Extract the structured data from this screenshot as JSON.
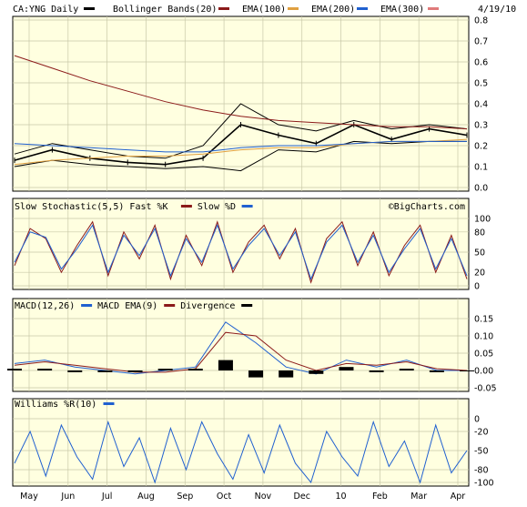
{
  "header": {
    "symbol_label": "CA:YNG Daily",
    "date": "4/19/10",
    "indicators": [
      {
        "label": "Bollinger Bands(20)",
        "color": "#000000"
      },
      {
        "label": "EMA(100)",
        "color": "#8b1a1a"
      },
      {
        "label": "EMA(200)",
        "color": "#e0a040"
      },
      {
        "label": "EMA(300)",
        "color": "#2060d0"
      }
    ],
    "ema300_swatch_color": "#e07a7a"
  },
  "watermark": "©BigCharts.com",
  "colors": {
    "panel_bg": "#ffffe0",
    "grid": "#c8c8a8",
    "price_bar": "#000000",
    "bollinger": "#000000",
    "ema100": "#8b1a1a",
    "ema200": "#e0a040",
    "ema300": "#2060d0",
    "fast_k": "#8b1a1a",
    "slow_d": "#2060d0",
    "macd": "#2060d0",
    "macd_ema": "#8b1a1a",
    "divergence": "#000000",
    "williams": "#2060d0"
  },
  "x_axis_labels": [
    "May",
    "Jun",
    "Jul",
    "Aug",
    "Sep",
    "Oct",
    "Nov",
    "Dec",
    "10",
    "Feb",
    "Mar",
    "Apr"
  ],
  "chart_data": [
    {
      "type": "line",
      "title": "CA:YNG Daily",
      "panel": "price",
      "ylim": [
        0.0,
        0.8
      ],
      "yticks": [
        "0.8",
        "0.7",
        "0.6",
        "0.5",
        "0.4",
        "0.3",
        "0.2",
        "0.1",
        "0.0"
      ],
      "x": [
        "May",
        "Jun",
        "Jul",
        "Aug",
        "Sep",
        "Oct",
        "Nov",
        "Dec",
        "10",
        "Feb",
        "Mar",
        "Apr"
      ],
      "series": [
        {
          "name": "Price",
          "values": [
            0.13,
            0.18,
            0.14,
            0.12,
            0.11,
            0.14,
            0.3,
            0.25,
            0.21,
            0.3,
            0.23,
            0.28,
            0.25
          ]
        },
        {
          "name": "Bollinger Bands(20) upper",
          "values": [
            0.16,
            0.21,
            0.18,
            0.15,
            0.14,
            0.2,
            0.4,
            0.3,
            0.27,
            0.32,
            0.28,
            0.3,
            0.28
          ]
        },
        {
          "name": "Bollinger Bands(20) lower",
          "values": [
            0.1,
            0.13,
            0.11,
            0.1,
            0.09,
            0.1,
            0.08,
            0.18,
            0.17,
            0.22,
            0.21,
            0.22,
            0.22
          ]
        },
        {
          "name": "EMA(100)",
          "values": [
            0.63,
            0.57,
            0.51,
            0.46,
            0.41,
            0.37,
            0.34,
            0.32,
            0.31,
            0.3,
            0.29,
            0.29,
            0.28
          ]
        },
        {
          "name": "EMA(200)",
          "values": [
            0.11,
            0.13,
            0.14,
            0.15,
            0.15,
            0.16,
            0.18,
            0.19,
            0.19,
            0.21,
            0.22,
            0.22,
            0.23
          ]
        },
        {
          "name": "EMA(300)",
          "values": [
            0.21,
            0.2,
            0.19,
            0.18,
            0.17,
            0.17,
            0.19,
            0.2,
            0.2,
            0.21,
            0.22,
            0.22,
            0.22
          ]
        }
      ]
    },
    {
      "type": "line",
      "title": "Slow Stochastic(5,5)",
      "panel": "stochastic",
      "legend": [
        {
          "label": "Slow Stochastic(5,5)  Fast %K"
        },
        {
          "label": "Slow %D"
        }
      ],
      "ylim": [
        0,
        100
      ],
      "yticks": [
        "100",
        "80",
        "50",
        "20",
        "0"
      ],
      "series": [
        {
          "name": "Fast %K",
          "values": [
            30,
            85,
            70,
            20,
            60,
            95,
            15,
            80,
            40,
            90,
            10,
            75,
            30,
            95,
            20,
            65,
            90,
            40,
            85,
            5,
            70,
            95,
            30,
            80,
            15,
            60,
            90,
            20,
            75,
            10
          ]
        },
        {
          "name": "Slow %D",
          "values": [
            35,
            80,
            72,
            25,
            55,
            90,
            20,
            75,
            45,
            85,
            15,
            70,
            35,
            90,
            25,
            60,
            85,
            45,
            80,
            10,
            65,
            90,
            35,
            75,
            20,
            55,
            85,
            25,
            70,
            15
          ]
        }
      ]
    },
    {
      "type": "line",
      "title": "MACD(12,26)",
      "panel": "macd",
      "legend": [
        {
          "label": "MACD(12,26)"
        },
        {
          "label": "MACD EMA(9)"
        },
        {
          "label": "Divergence"
        }
      ],
      "ylim": [
        -0.05,
        0.15
      ],
      "yticks": [
        "0.15",
        "0.10",
        "0.05",
        "0.00",
        "-0.05"
      ],
      "series": [
        {
          "name": "MACD",
          "values": [
            0.02,
            0.03,
            0.01,
            0.0,
            -0.01,
            0.0,
            0.01,
            0.14,
            0.08,
            0.01,
            -0.01,
            0.03,
            0.01,
            0.03,
            0.0,
            0.0
          ]
        },
        {
          "name": "MACD EMA(9)",
          "values": [
            0.015,
            0.025,
            0.015,
            0.005,
            -0.005,
            -0.005,
            0.005,
            0.11,
            0.1,
            0.03,
            0.0,
            0.02,
            0.015,
            0.025,
            0.005,
            0.0
          ]
        },
        {
          "name": "Divergence",
          "values": [
            0.005,
            0.005,
            -0.005,
            -0.005,
            -0.005,
            0.005,
            0.005,
            0.03,
            -0.02,
            -0.02,
            -0.01,
            0.01,
            -0.005,
            0.005,
            -0.005,
            0.0
          ]
        }
      ]
    },
    {
      "type": "line",
      "title": "Williams %R(10)",
      "panel": "williams",
      "legend": [
        {
          "label": "Williams %R(10)"
        }
      ],
      "ylim": [
        -100,
        0
      ],
      "yticks": [
        "0",
        "-20",
        "-50",
        "-80",
        "-100"
      ],
      "series": [
        {
          "name": "Williams %R",
          "values": [
            -70,
            -20,
            -90,
            -10,
            -60,
            -95,
            -5,
            -75,
            -30,
            -100,
            -15,
            -80,
            -5,
            -55,
            -95,
            -25,
            -85,
            -10,
            -70,
            -100,
            -20,
            -60,
            -90,
            -5,
            -75,
            -35,
            -100,
            -10,
            -85,
            -50
          ]
        }
      ]
    }
  ]
}
